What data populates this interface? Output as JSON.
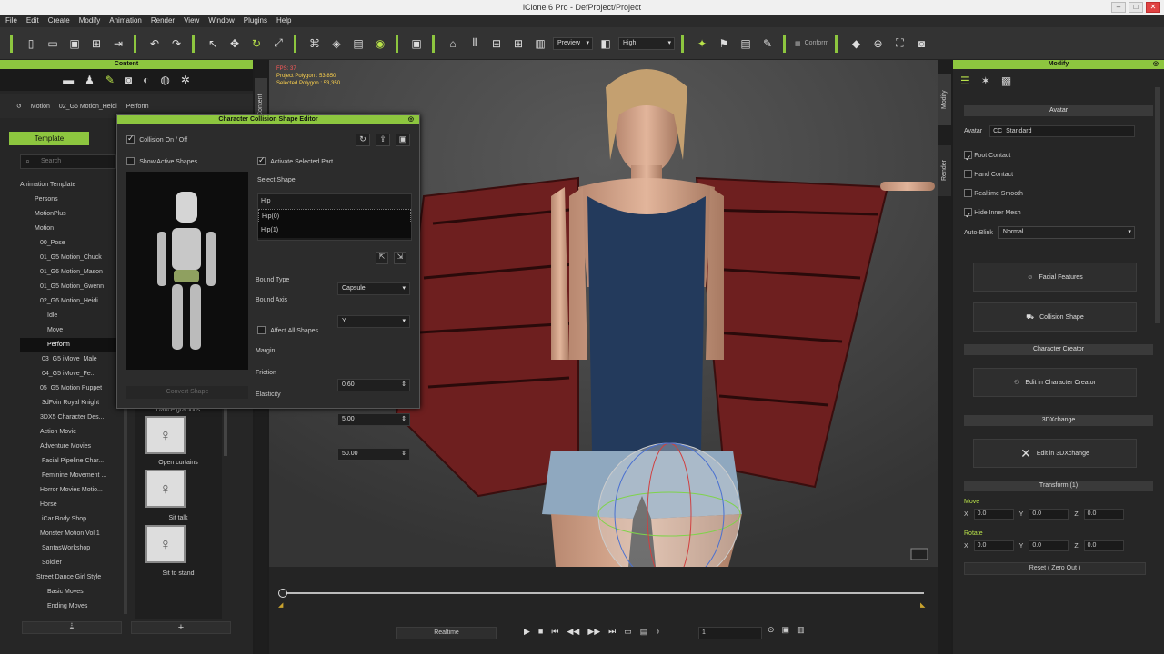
{
  "window": {
    "title": "iClone 6 Pro - DefProject/Project"
  },
  "menu": [
    "File",
    "Edit",
    "Create",
    "Modify",
    "Animation",
    "Render",
    "View",
    "Window",
    "Plugins",
    "Help"
  ],
  "toolbar": {
    "preview_label": "Preview",
    "quality_label": "High",
    "conform_label": "Conform"
  },
  "content_panel": {
    "title": "Content",
    "breadcrumb": [
      "Motion",
      "02_G6 Motion_Heidi",
      "Perform"
    ],
    "tab_template": "Template",
    "search_placeholder": "Search",
    "tree": [
      {
        "label": "Animation Template"
      },
      {
        "label": "Persons"
      },
      {
        "label": "MotionPlus"
      },
      {
        "label": "Motion"
      },
      {
        "label": "00_Pose"
      },
      {
        "label": "01_G5 Motion_Chuck"
      },
      {
        "label": "01_G6 Motion_Mason"
      },
      {
        "label": "01_G5 Motion_Gwenn"
      },
      {
        "label": "02_G6 Motion_Heidi"
      },
      {
        "label": "Idle"
      },
      {
        "label": "Move"
      },
      {
        "label": "Perform"
      },
      {
        "label": "03_G5 iMove_Male"
      },
      {
        "label": "04_G5 iMove_Fe..."
      },
      {
        "label": "05_G5 Motion Puppet"
      },
      {
        "label": "3dFoin Royal Knight"
      },
      {
        "label": "3DX5 Character Des..."
      },
      {
        "label": "Action Movie"
      },
      {
        "label": "Adventure Movies"
      },
      {
        "label": "Facial Pipeline Char..."
      },
      {
        "label": "Feminine Movement ..."
      },
      {
        "label": "Horror Movies Motio..."
      },
      {
        "label": "Horse"
      },
      {
        "label": "iCar Body Shop"
      },
      {
        "label": "Monster Motion Vol 1"
      },
      {
        "label": "SantasWorkshop"
      },
      {
        "label": "Soldier"
      },
      {
        "label": "Street Dance Girl Style"
      },
      {
        "label": "Basic Moves"
      },
      {
        "label": "Ending Moves"
      }
    ],
    "thumbs": [
      {
        "caption": "Dance gracious"
      },
      {
        "caption": "Open curtains"
      },
      {
        "caption": "Sit talk"
      },
      {
        "caption": "Sit to stand"
      }
    ]
  },
  "dialog": {
    "title": "Character Collision Shape Editor",
    "collision_toggle": "Collision On / Off",
    "show_active": "Show Active Shapes",
    "activate_selected": "Activate Selected Part",
    "select_shape": "Select Shape",
    "shapes": [
      "Hip",
      "Hip(0)",
      "Hip(1)"
    ],
    "bound_type_label": "Bound Type",
    "bound_type_value": "Capsule",
    "bound_axis_label": "Bound Axis",
    "bound_axis_value": "Y",
    "affect_all": "Affect All Shapes",
    "margin_label": "Margin",
    "margin_value": "0.60",
    "friction_label": "Friction",
    "friction_value": "5.00",
    "elasticity_label": "Elasticity",
    "elasticity_value": "50.00",
    "convert_label": "Convert Shape"
  },
  "viewport": {
    "fps": "FPS: 37",
    "project_polys": "Project Polygon : 53,850",
    "selected_polys": "Selected Polygon : 53,350"
  },
  "side_tabs": {
    "content": "Content",
    "modify": "Modify",
    "render": "Render"
  },
  "timeline": {
    "realtime_label": "Realtime",
    "frame_value": "1"
  },
  "modify_panel": {
    "title": "Modify",
    "avatar_section": "Avatar",
    "avatar_label": "Avatar",
    "avatar_value": "CC_Standard",
    "foot_contact": "Foot Contact",
    "hand_contact": "Hand Contact",
    "realtime_smooth": "Realtime Smooth",
    "hide_inner_mesh": "Hide Inner Mesh",
    "auto_blink_label": "Auto-Blink",
    "auto_blink_value": "Normal",
    "facial_features": "Facial Features",
    "collision_shape": "Collision Shape",
    "cc_section": "Character Creator",
    "edit_cc": "Edit in Character Creator",
    "x3d_section": "3DXchange",
    "edit_3dx": "Edit in 3DXchange",
    "transform_section": "Transform (1)",
    "move_label": "Move",
    "rotate_label": "Rotate",
    "axis_x": "X",
    "axis_y": "Y",
    "axis_z": "Z",
    "zero_value": "0.0",
    "reset_label": "Reset ( Zero Out )"
  }
}
